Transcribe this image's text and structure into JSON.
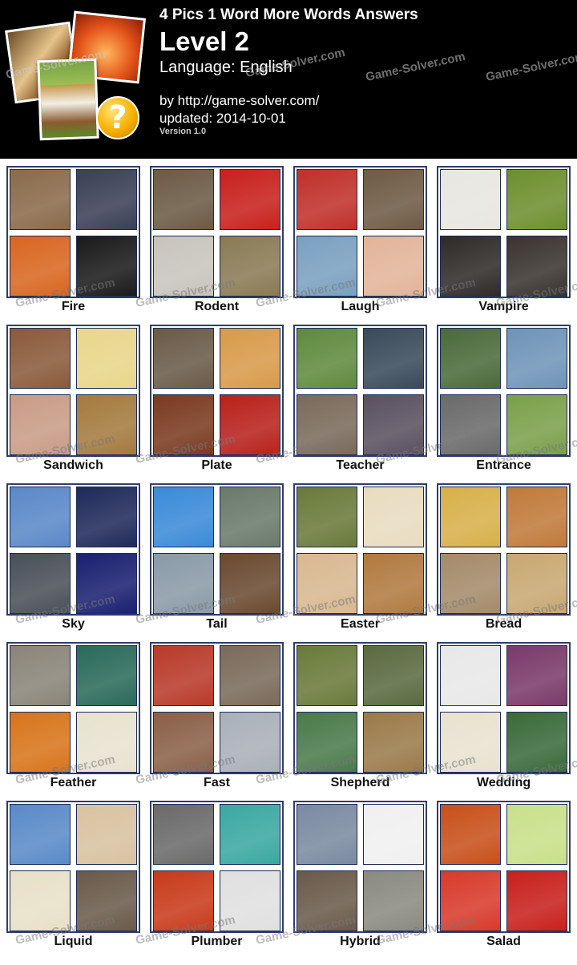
{
  "header": {
    "title": "4 Pics 1 Word More Words Answers",
    "level": "Level 2",
    "language": "Language: English",
    "by": "by http://game-solver.com/",
    "updated": "updated: 2014-10-01",
    "version": "Version 1.0",
    "logo_mark": "?"
  },
  "watermark": "Game-Solver.com",
  "puzzles": [
    {
      "answer": "Fire",
      "tiles": [
        "#8a6a4a",
        "#3b3f55",
        "#d8661f",
        "#1a1a1a"
      ]
    },
    {
      "answer": "Rodent",
      "tiles": [
        "#6b5a45",
        "#c8201c",
        "#c8c4bd",
        "#8a7a55"
      ]
    },
    {
      "answer": "Laugh",
      "tiles": [
        "#c0302a",
        "#6e5a45",
        "#7aa0c0",
        "#e2b49a"
      ]
    },
    {
      "answer": "Vampire",
      "tiles": [
        "#e8e6e0",
        "#6d8f2e",
        "#2e2a28",
        "#3a3330"
      ]
    },
    {
      "answer": "Sandwich",
      "tiles": [
        "#8a5a3a",
        "#e8d68a",
        "#c89c86",
        "#a47a3e"
      ]
    },
    {
      "answer": "Plate",
      "tiles": [
        "#6a5a48",
        "#d89a4a",
        "#7a3a20",
        "#b8211b"
      ]
    },
    {
      "answer": "Teacher",
      "tiles": [
        "#5f8a3e",
        "#394a5a",
        "#7a6a5a",
        "#5a5060"
      ]
    },
    {
      "answer": "Entrance",
      "tiles": [
        "#4a6a3a",
        "#6f94b8",
        "#6a6a6a",
        "#7aa04a"
      ]
    },
    {
      "answer": "Sky",
      "tiles": [
        "#5a88c8",
        "#1f2a5a",
        "#4a5058",
        "#1a2070"
      ]
    },
    {
      "answer": "Tail",
      "tiles": [
        "#3a8ad8",
        "#6a7a6a",
        "#8a9aa8",
        "#6a4a30"
      ]
    },
    {
      "answer": "Easter",
      "tiles": [
        "#6a7a3a",
        "#e8dcc0",
        "#d8b890",
        "#b07a40"
      ]
    },
    {
      "answer": "Bread",
      "tiles": [
        "#d8b04a",
        "#c07a3a",
        "#a48a6a",
        "#c8a872"
      ]
    },
    {
      "answer": "Feather",
      "tiles": [
        "#8a8478",
        "#2a6a5a",
        "#d8741a",
        "#e8e2d0"
      ]
    },
    {
      "answer": "Fast",
      "tiles": [
        "#b83a2a",
        "#7a6a5a",
        "#8a6048",
        "#aab0b8"
      ]
    },
    {
      "answer": "Shepherd",
      "tiles": [
        "#6a7a3a",
        "#5a6a40",
        "#4a7a4a",
        "#9a7a4a"
      ]
    },
    {
      "answer": "Wedding",
      "tiles": [
        "#e8e8e8",
        "#7a3a6a",
        "#e8e2d0",
        "#3a6a3a"
      ]
    },
    {
      "answer": "Liquid",
      "tiles": [
        "#5a8ac8",
        "#d8c2a0",
        "#e8e0c8",
        "#6a5a4a"
      ]
    },
    {
      "answer": "Plumber",
      "tiles": [
        "#6a6a6a",
        "#3aa8a0",
        "#c83a1a",
        "#e0e0e0"
      ]
    },
    {
      "answer": "Hybrid",
      "tiles": [
        "#7a8aa0",
        "#f0f0f0",
        "#6a5a4a",
        "#8a8a80"
      ]
    },
    {
      "answer": "Salad",
      "tiles": [
        "#c8501a",
        "#c8e08a",
        "#d83a2a",
        "#c8201c"
      ]
    }
  ]
}
